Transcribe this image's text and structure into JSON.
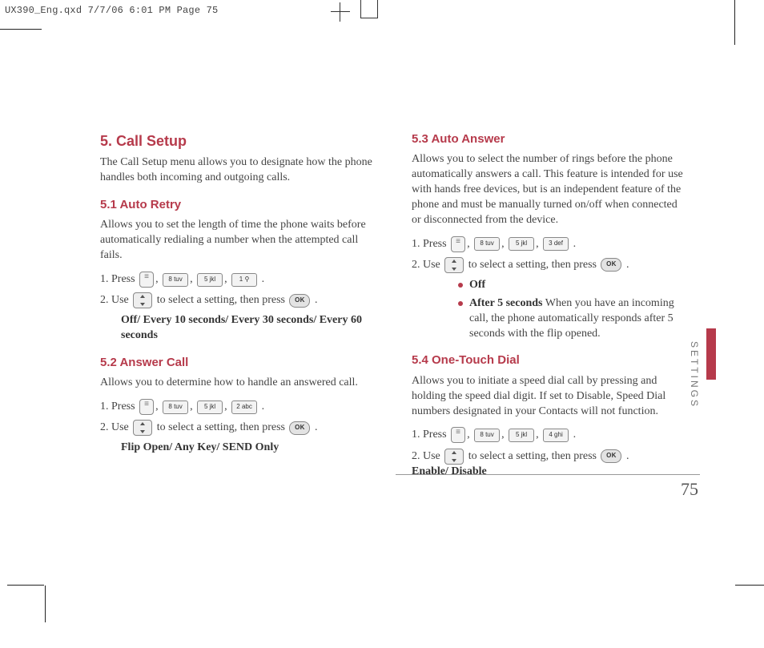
{
  "slug": "UX390_Eng.qxd  7/7/06  6:01 PM  Page 75",
  "side_label": "SETTINGS",
  "page_number": "75",
  "keys": {
    "k1": "1 ⚲",
    "k2": "2 abc",
    "k3": "3 def",
    "k4": "4 ghi",
    "k5": "5 jkl",
    "k8": "8 tuv",
    "ok": "OK"
  },
  "left": {
    "h1": "5. Call Setup",
    "intro": "The Call Setup menu allows you to designate how the phone handles both incoming and outgoing calls.",
    "s1": {
      "title": "5.1 Auto Retry",
      "desc": "Allows you to set the length of time the phone waits before automatically redialing a number when the attempted call fails.",
      "step1_a": "1. Press ",
      "step2_a": "2. Use ",
      "step2_b": " to select a setting, then press ",
      "options": "Off/ Every 10 seconds/ Every 30 seconds/ Every 60 seconds"
    },
    "s2": {
      "title": "5.2 Answer Call",
      "desc": "Allows you to determine how to handle an answered call.",
      "step1_a": "1. Press ",
      "step2_a": "2. Use ",
      "step2_b": " to select a setting, then press ",
      "options": "Flip Open/ Any Key/ SEND Only"
    }
  },
  "right": {
    "s3": {
      "title": "5.3 Auto Answer",
      "desc": "Allows you to select the number of rings before the phone automatically answers a call. This feature is intended for use with hands free devices, but is an independent feature of the phone and must be manually turned on/off when connected or disconnected from the device.",
      "step1_a": "1. Press ",
      "step2_a": "2. Use ",
      "step2_b": " to select a setting, then press ",
      "b1": "Off",
      "b2_bold": "After 5 seconds",
      "b2_rest": " When you have an incoming call, the phone automatically responds after 5 seconds with the flip opened."
    },
    "s4": {
      "title": "5.4 One-Touch Dial",
      "desc": "Allows you to initiate a speed dial call by pressing and holding the speed dial digit. If set to Disable, Speed Dial numbers designated in your Contacts will not function.",
      "step1_a": "1. Press ",
      "step2_a": "2. Use ",
      "step2_b": " to select a setting, then press ",
      "options": "Enable/ Disable"
    }
  },
  "sep": {
    "comma": ", ",
    "period": " ."
  }
}
